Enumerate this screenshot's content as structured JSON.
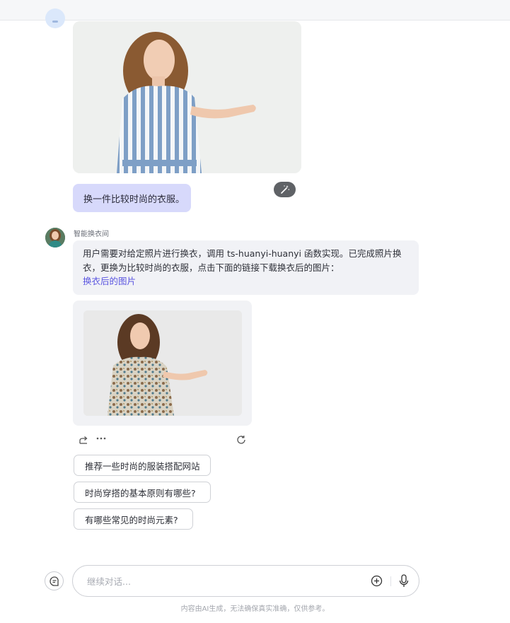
{
  "conversation": {
    "user_message": "换一件比较时尚的衣服。",
    "bot_name": "智能换衣间",
    "bot_reply": "用户需要对给定照片进行换衣，调用 ts-huanyi-huanyi 函数实现。已完成照片换衣，更换为比较时尚的衣服，点击下面的链接下载换衣后的图片：",
    "bot_link": "换衣后的图片"
  },
  "suggestions": [
    "推荐一些时尚的服装搭配网站",
    "时尚穿搭的基本原则有哪些?",
    "有哪些常见的时尚元素?"
  ],
  "composer": {
    "placeholder": "继续对话..."
  },
  "footer": {
    "disclaimer": "内容由AI生成，无法确保真实准确，仅供参考。"
  },
  "icons": {
    "magic": "magic-wand-icon",
    "share": "share-icon",
    "more": "more-icon",
    "refresh": "refresh-icon",
    "chat_mode": "chat-mode-icon",
    "add": "plus-circle-icon",
    "mic": "microphone-icon"
  },
  "colors": {
    "user_bubble": "#d7d9fb",
    "bot_bubble": "#f1f2f6",
    "link": "#5a55e0"
  }
}
